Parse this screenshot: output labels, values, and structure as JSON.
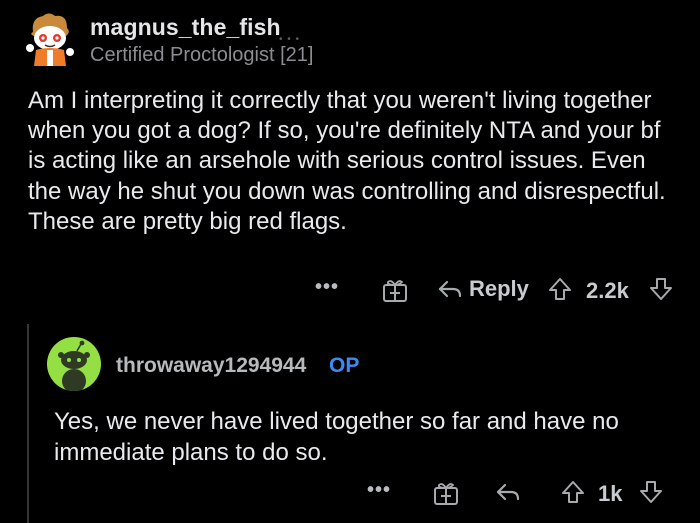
{
  "comment": {
    "author": "magnus_the_fish",
    "flair": "Certified Proctologist [21]",
    "extra_marks": "• • •",
    "body": "Am I interpreting it correctly that you weren't living together when you got a dog? If so, you're definitely NTA and your bf is acting like an arsehole with serious control issues. Even the way he shut you down was controlling and disrespectful. These are pretty big red flags.",
    "actions": {
      "more": "•••",
      "reply": "Reply",
      "score": "2.2k"
    }
  },
  "reply": {
    "author": "throwaway1294944",
    "op_badge": "OP",
    "body": "Yes, we never have lived together so far and have no immediate plans to do so.",
    "actions": {
      "more": "•••",
      "score": "1k"
    }
  },
  "colors": {
    "background": "#000000",
    "text": "#e8eaed",
    "muted": "#8a8d91",
    "op": "#3d8af7",
    "avatar_green": "#94e044",
    "thread_line": "#343536"
  },
  "icons": [
    "more-icon",
    "award-gift-icon",
    "reply-arrow-icon",
    "upvote-icon",
    "downvote-icon",
    "snoo-avatar-icon"
  ]
}
